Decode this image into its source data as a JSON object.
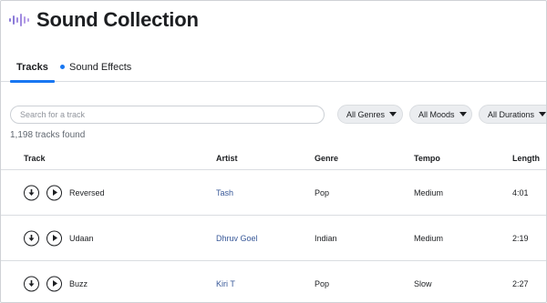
{
  "app": {
    "title": "Sound Collection",
    "logo_icon": "sound-wave-icon",
    "accent_color": "#1877f2",
    "link_color": "#385898"
  },
  "tabs": [
    {
      "label": "Tracks",
      "active": true
    },
    {
      "label": "Sound Effects",
      "active": false,
      "indicator": "blue-dot"
    }
  ],
  "search": {
    "placeholder": "Search for a track",
    "value": ""
  },
  "filters": [
    {
      "label": "All Genres",
      "icon": "caret-down-icon"
    },
    {
      "label": "All Moods",
      "icon": "caret-down-icon"
    },
    {
      "label": "All Durations",
      "icon": "caret-down-icon"
    }
  ],
  "results_count": "1,198 tracks found",
  "table": {
    "columns": [
      "Track",
      "Artist",
      "Genre",
      "Tempo",
      "Length"
    ],
    "rows": [
      {
        "track": "Reversed",
        "artist": "Tash",
        "genre": "Pop",
        "tempo": "Medium",
        "length": "4:01"
      },
      {
        "track": "Udaan",
        "artist": "Dhruv Goel",
        "genre": "Indian",
        "tempo": "Medium",
        "length": "2:19"
      },
      {
        "track": "Buzz",
        "artist": "Kiri T",
        "genre": "Pop",
        "tempo": "Slow",
        "length": "2:27"
      }
    ]
  }
}
